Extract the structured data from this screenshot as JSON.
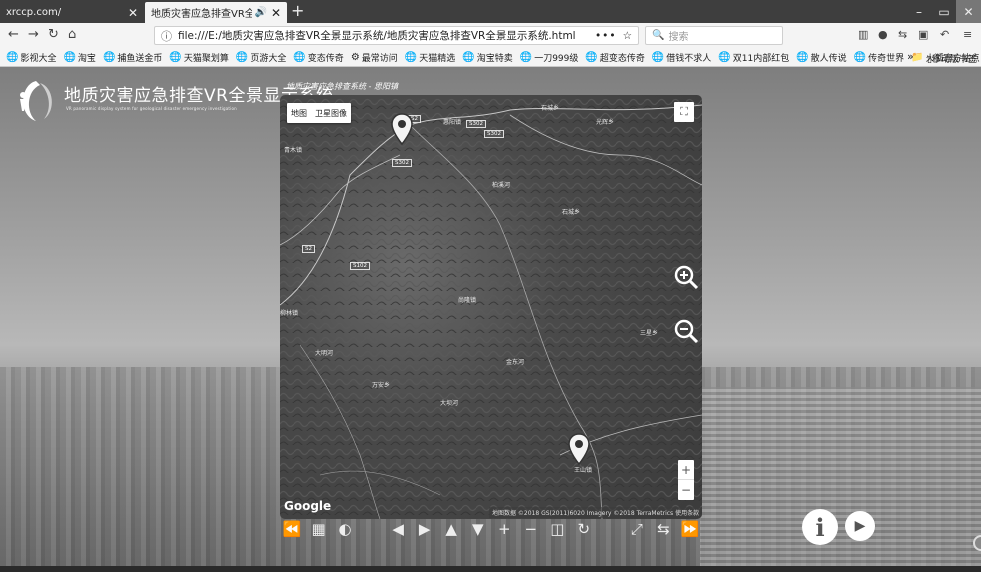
{
  "browser": {
    "tabs": [
      {
        "label": "xrccp.com/",
        "active": false
      },
      {
        "label": "地质灾害应急排查VR全景显示系",
        "active": true
      }
    ],
    "new_tab": "+",
    "window_controls": {
      "minimize": "–",
      "maximize": "▭",
      "close": "✕"
    },
    "url": "file:///E:/地质灾害应急排查VR全景显示系统/地质灾害应急排查VR全景显示系统.html",
    "url_actions": "•••",
    "search_placeholder": "搜索",
    "bookmarks": [
      "影视大全",
      "淘宝",
      "捕鱼送金币",
      "天猫聚划算",
      "页游大全",
      "变态传奇",
      "最常访问",
      "天猫精选",
      "淘宝特卖",
      "一刀999级",
      "超变态传奇",
      "借钱不求人",
      "双11内部红包",
      "散人传说",
      "传奇世界",
      "火狐官方站点"
    ],
    "bookmarks_more": "»",
    "mobile_bookmarks": "移动版书签"
  },
  "page": {
    "title": "地质灾害应急排查VR全景显示系统",
    "subtitle": "VR panoramic display system for geological disaster emergency investigation",
    "map_caption": "地质灾害应急排查系统 - 思阳镇"
  },
  "map": {
    "type_options": [
      "地图",
      "卫星图像"
    ],
    "fullscreen_icon": "⛶",
    "zoom_in": "+",
    "zoom_out": "−",
    "google": "Google",
    "attribution": "地图数据 ©2018 GS(2011)6020 Imagery ©2018 TerraMetrics   使用条款",
    "places": [
      {
        "name": "惠阳镇"
      },
      {
        "name": "石城乡"
      },
      {
        "name": "光辉乡"
      },
      {
        "name": "石城乡"
      },
      {
        "name": "尚隆镇"
      },
      {
        "name": "三星乡"
      },
      {
        "name": "柳林镇"
      },
      {
        "name": "大明河"
      },
      {
        "name": "万安乡"
      },
      {
        "name": "金东河"
      },
      {
        "name": "大坝河"
      },
      {
        "name": "王山镇"
      },
      {
        "name": "青木镇"
      },
      {
        "name": "柏溪河"
      }
    ],
    "roads": [
      "S302",
      "S302",
      "S302",
      "S2",
      "S2",
      "S102"
    ]
  },
  "toolbar": {
    "icons": [
      "⏪",
      "▦",
      "◐",
      "",
      "◀",
      "▶",
      "▲",
      "▼",
      "+",
      "−",
      "◫",
      "↻",
      "",
      "⤢",
      "⇆",
      "⏩"
    ]
  },
  "buttons": {
    "info": "i",
    "play": "▶"
  }
}
